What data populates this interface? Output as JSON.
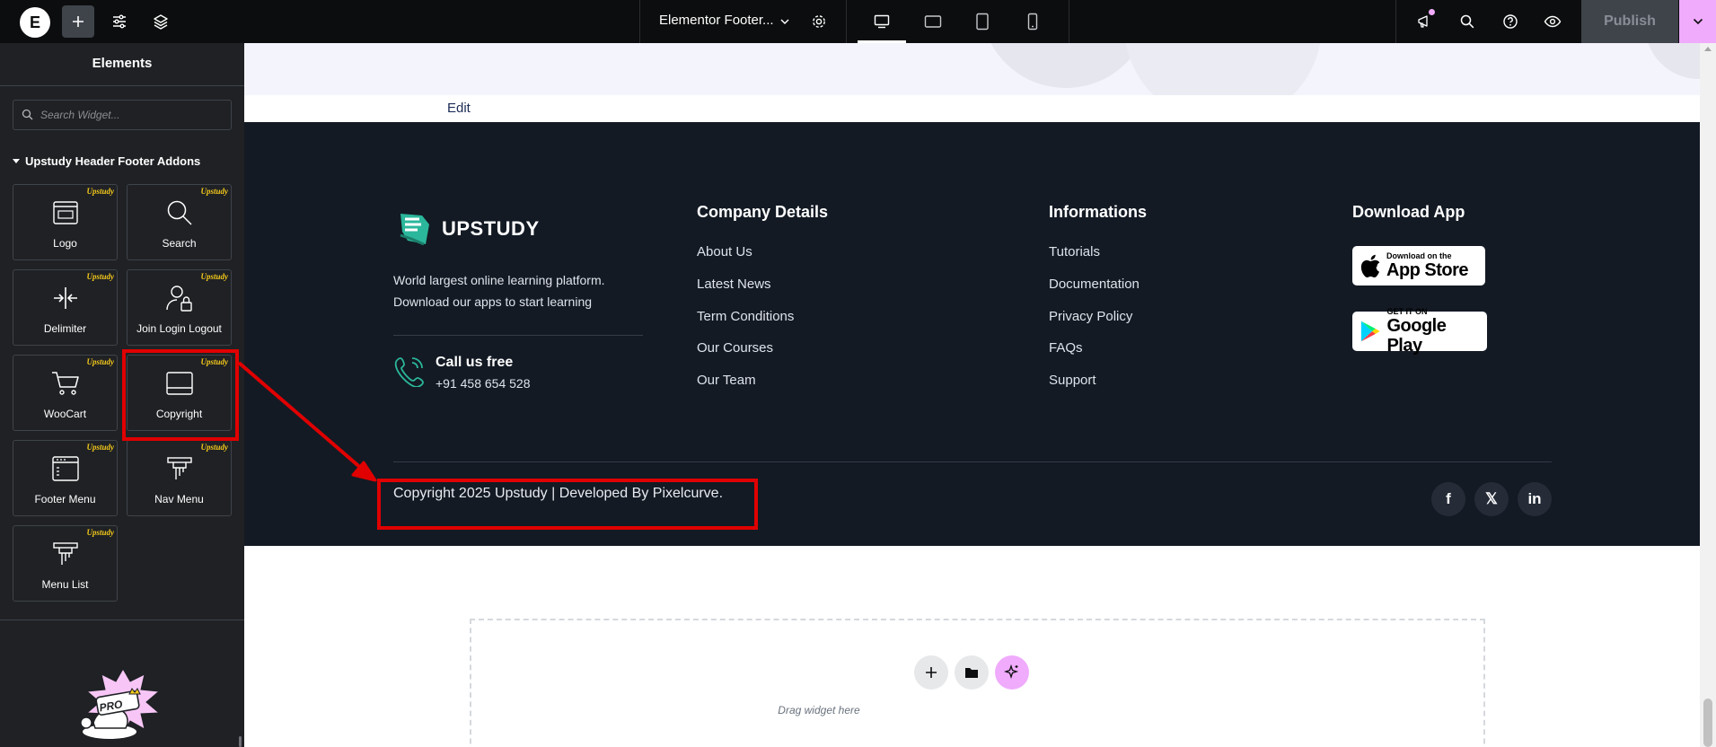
{
  "topbar": {
    "logo_letter": "E",
    "document_title": "Elementor Footer...",
    "publish_label": "Publish"
  },
  "sidebar": {
    "title": "Elements",
    "search_placeholder": "Search Widget...",
    "category_label": "Upstudy Header Footer Addons",
    "badge_label": "Upstudy",
    "widgets": [
      {
        "label": "Logo",
        "icon": "logo-widget-icon"
      },
      {
        "label": "Search",
        "icon": "search-widget-icon"
      },
      {
        "label": "Delimiter",
        "icon": "delimiter-widget-icon"
      },
      {
        "label": "Join Login Logout",
        "icon": "login-widget-icon"
      },
      {
        "label": "WooCart",
        "icon": "cart-widget-icon"
      },
      {
        "label": "Copyright",
        "icon": "copyright-widget-icon"
      },
      {
        "label": "Footer Menu",
        "icon": "footer-menu-widget-icon"
      },
      {
        "label": "Nav Menu",
        "icon": "nav-menu-widget-icon"
      },
      {
        "label": "Menu List",
        "icon": "menu-list-widget-icon"
      }
    ],
    "pro_label": "PRO"
  },
  "canvas": {
    "edit_label": "Edit",
    "footer": {
      "brand_name": "UPSTUDY",
      "about_line1": "World largest online learning platform.",
      "about_line2": "Download our apps to start learning",
      "call_title": "Call us free",
      "call_number": "+91 458 654 528",
      "company": {
        "title": "Company Details",
        "links": [
          "About Us",
          "Latest News",
          "Term Conditions",
          "Our Courses",
          "Our Team"
        ]
      },
      "informations": {
        "title": "Informations",
        "links": [
          "Tutorials",
          "Documentation",
          "Privacy Policy",
          "FAQs",
          "Support"
        ]
      },
      "download": {
        "title": "Download App",
        "app_store_small": "Download on the",
        "app_store_big": "App Store",
        "google_play_small": "GET IT ON",
        "google_play_big": "Google Play"
      },
      "copyright": "Copyright 2025 Upstudy | Developed By Pixelcurve.",
      "social": [
        {
          "glyph": "f",
          "icon": "facebook-icon"
        },
        {
          "glyph": "𝕏",
          "icon": "x-icon"
        },
        {
          "glyph": "in",
          "icon": "linkedin-icon"
        }
      ]
    },
    "dropzone_label": "Drag widget here"
  },
  "colors": {
    "annotation": "#e00000",
    "accent_pink": "#f0abfc",
    "footer_bg": "#131a24",
    "badge_yellow": "#f3c81b"
  }
}
